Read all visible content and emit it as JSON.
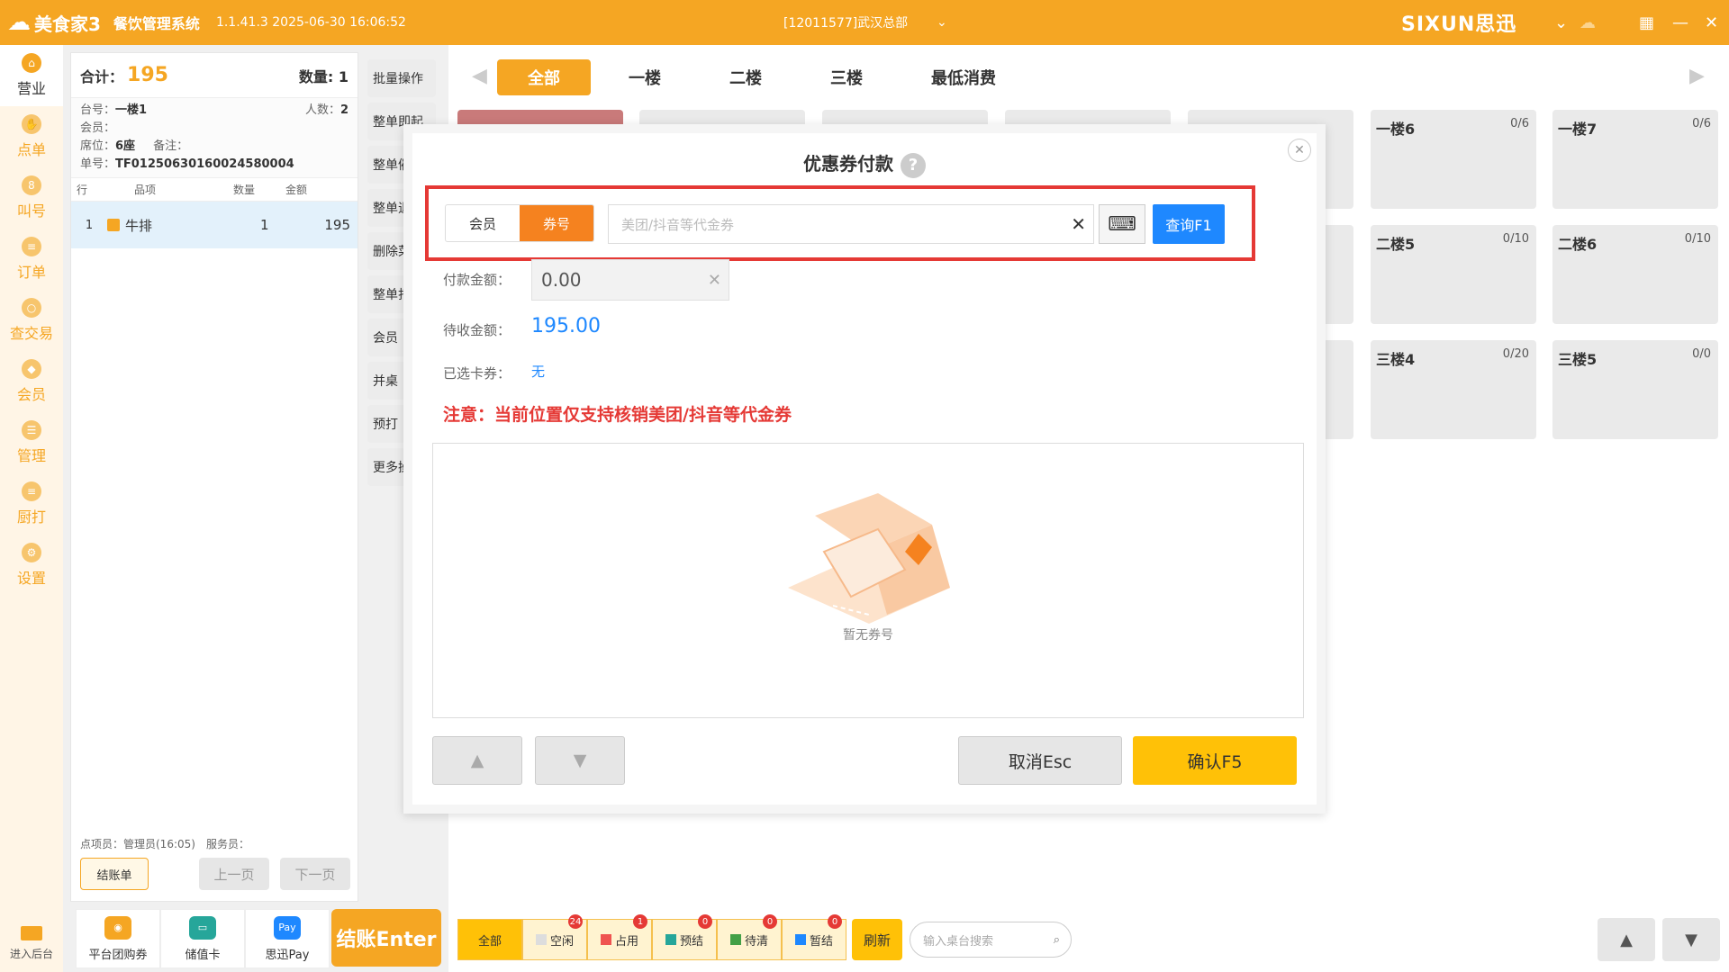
{
  "titlebar": {
    "app_name": "美食家3",
    "system_name": "餐饮管理系统",
    "version": "1.1.41.3 2025-06-30 16:06:52",
    "store": "[12011577]武汉总部",
    "brand": "SIXUN思迅"
  },
  "nav": [
    {
      "label": "营业",
      "icon": "home-icon"
    },
    {
      "label": "点单",
      "icon": "hand-icon"
    },
    {
      "label": "叫号",
      "icon": "ticket-icon"
    },
    {
      "label": "订单",
      "icon": "document-icon"
    },
    {
      "label": "查交易",
      "icon": "search-icon"
    },
    {
      "label": "会员",
      "icon": "diamond-icon"
    },
    {
      "label": "管理",
      "icon": "list-icon"
    },
    {
      "label": "厨打",
      "icon": "printer-icon"
    },
    {
      "label": "设置",
      "icon": "gear-icon"
    }
  ],
  "nav_bottom": "进入后台",
  "order": {
    "total_label": "合计：",
    "total_value": "195",
    "qty_label": "数量:",
    "qty_value": "1",
    "table_label": "台号：",
    "table_value": "一楼1",
    "people_label": "人数：",
    "people_value": "2",
    "member_label": "会员：",
    "seat_label": "席位：",
    "seat_value": "6座",
    "remark_label": "备注：",
    "order_no_label": "单号：",
    "order_no": "TF01250630160024580004",
    "columns": [
      "行",
      "品项",
      "数量",
      "金额"
    ],
    "lines": [
      {
        "row": "1",
        "name": "牛排",
        "qty": "1",
        "amount": "195"
      }
    ],
    "footer": "点项员：管理员(16:05)　服务员：",
    "bill_button": "结账单",
    "prev_page": "上一页",
    "next_page": "下一页"
  },
  "side_ops": [
    "批量操作",
    "整单即起",
    "整单催",
    "整单退",
    "删除菜",
    "整单打",
    "会员",
    "并桌",
    "预打",
    "更多操"
  ],
  "pay": [
    {
      "label": "平台团购券",
      "icon": "coupon-icon",
      "color": "#f5a623"
    },
    {
      "label": "储值卡",
      "icon": "card-icon",
      "color": "#26a69a"
    },
    {
      "label": "思迅Pay",
      "icon": "pay-icon",
      "color": "#1e88ff"
    }
  ],
  "checkout_label": "结账Enter",
  "floor_tabs": [
    "全部",
    "一楼",
    "二楼",
    "三楼",
    "最低消费"
  ],
  "tables": [
    {
      "name": "一楼6",
      "count": "0/6"
    },
    {
      "name": "一楼7",
      "count": "0/6"
    },
    {
      "name": "二楼5",
      "count": "0/10"
    },
    {
      "name": "二楼6",
      "count": "0/10"
    },
    {
      "name": "三楼4",
      "count": "0/20"
    },
    {
      "name": "三楼5",
      "count": "0/0"
    }
  ],
  "status": [
    {
      "label": "全部",
      "badge": "",
      "color": ""
    },
    {
      "label": "空闲",
      "badge": "24",
      "color": "#dddddd"
    },
    {
      "label": "占用",
      "badge": "1",
      "color": "#ef5350"
    },
    {
      "label": "预结",
      "badge": "0",
      "color": "#26a69a"
    },
    {
      "label": "待清",
      "badge": "0",
      "color": "#43a047"
    },
    {
      "label": "暂结",
      "badge": "0",
      "color": "#1e88ff"
    }
  ],
  "refresh": "刷新",
  "table_search": {
    "placeholder": "输入桌台搜索"
  },
  "modal": {
    "title": "优惠券付款",
    "help": "?",
    "seg_member": "会员",
    "seg_coupon": "券号",
    "coupon_placeholder": "美团/抖音等代金券",
    "query_button": "查询F1",
    "pay_amount_label": "付款金额：",
    "pay_amount": "0.00",
    "due_label": "待收金额：",
    "due_amount": "195.00",
    "selected_label": "已选卡券：",
    "selected_value": "无",
    "notice": "注意：当前位置仅支持核销美团/抖音等代金券",
    "empty_text": "暂无券号",
    "cancel_button": "取消Esc",
    "confirm_button": "确认F5"
  }
}
